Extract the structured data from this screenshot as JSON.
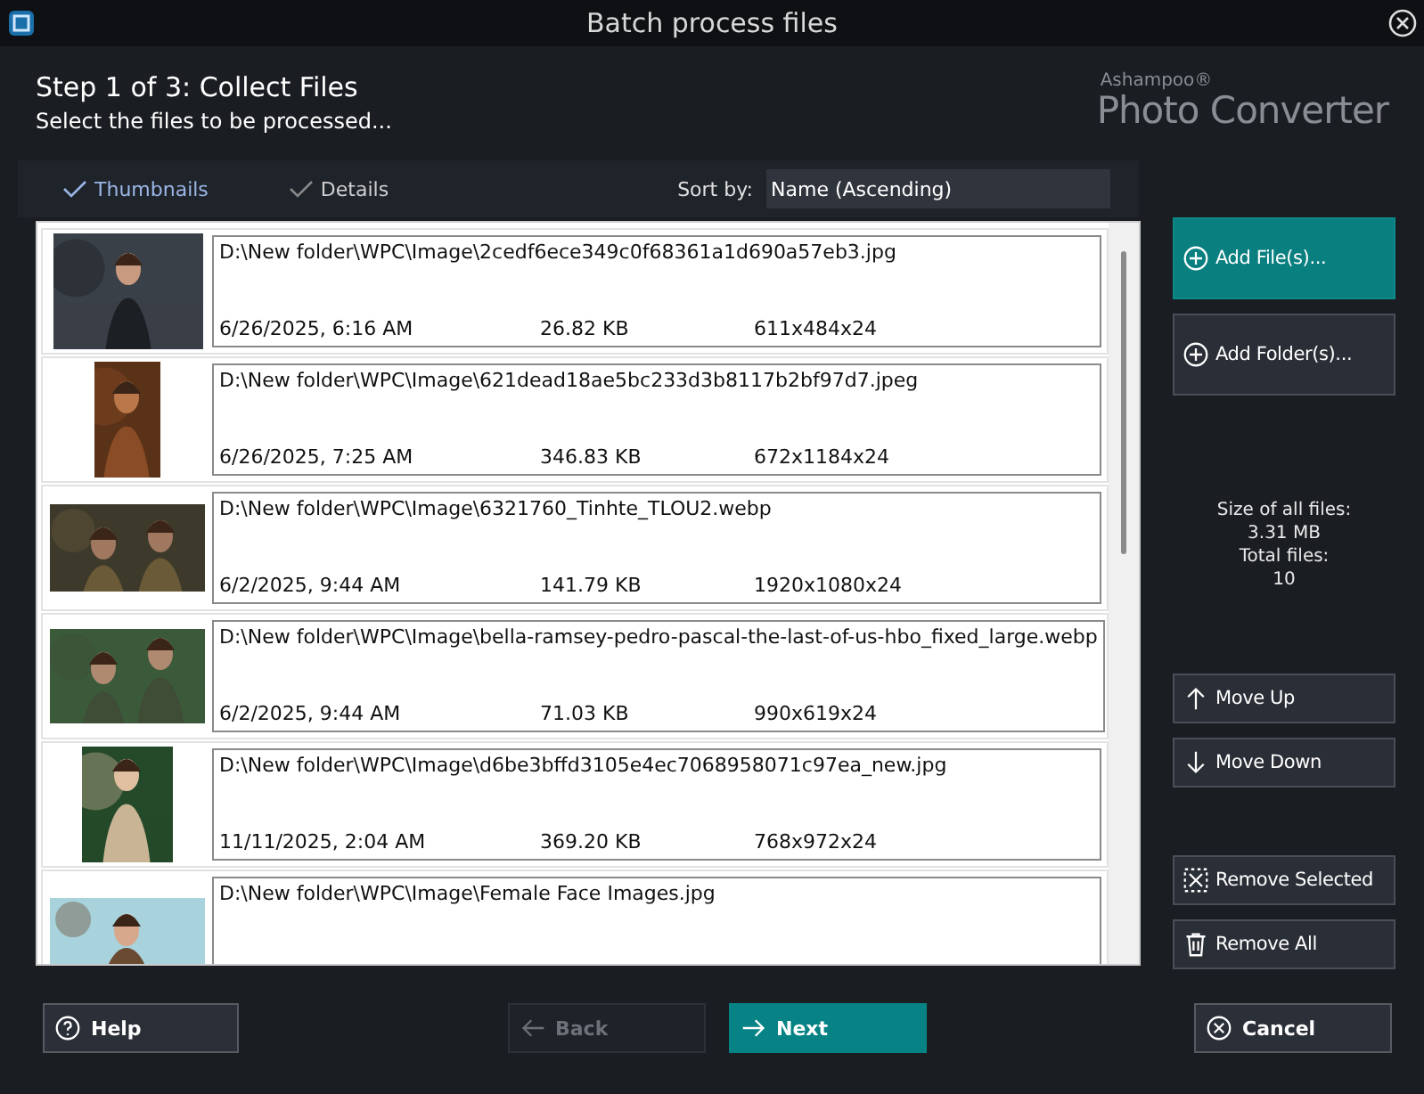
{
  "window": {
    "title": "Batch process files"
  },
  "header": {
    "step": "Step 1 of 3: Collect Files",
    "subtitle": "Select the files to be processed...",
    "brand_small": "Ashampoo®",
    "brand_large": "Photo Converter"
  },
  "views": [
    {
      "label": "Thumbnails",
      "selected": true
    },
    {
      "label": "Details",
      "selected": false
    }
  ],
  "sort": {
    "label": "Sort by:",
    "value": "Name (Ascending)"
  },
  "files": [
    {
      "kind": "picture",
      "path": "D:\\New folder\\WPC\\Image\\2cedf6ece349c0f68361a1d690a57eb3.jpg",
      "date": "6/26/2025, 6:16 AM",
      "size": "26.82 KB",
      "dimensions": "611x484x24"
    },
    {
      "kind": "picture",
      "path": "D:\\New folder\\WPC\\Image\\621dead18ae5bc233d3b8117b2bf97d7.jpeg",
      "date": "6/26/2025, 7:25 AM",
      "size": "346.83 KB",
      "dimensions": "672x1184x24"
    },
    {
      "kind": "picture",
      "path": "D:\\New folder\\WPC\\Image\\6321760_Tinhte_TLOU2.webp",
      "date": "6/2/2025, 9:44 AM",
      "size": "141.79 KB",
      "dimensions": "1920x1080x24"
    },
    {
      "kind": "picture",
      "path": "D:\\New folder\\WPC\\Image\\bella-ramsey-pedro-pascal-the-last-of-us-hbo_fixed_large.webp",
      "date": "6/2/2025, 9:44 AM",
      "size": "71.03 KB",
      "dimensions": "990x619x24"
    },
    {
      "kind": "picture",
      "path": "D:\\New folder\\WPC\\Image\\d6be3bffd3105e4ec7068958071c97ea_new.jpg",
      "date": "11/11/2025, 2:04 AM",
      "size": "369.20 KB",
      "dimensions": "768x972x24"
    },
    {
      "kind": "picture",
      "path": "D:\\New folder\\WPC\\Image\\Female Face Images.jpg"
    }
  ],
  "side_buttons": [
    {
      "label": "Add File(s)...",
      "primary": true
    },
    {
      "label": "Add Folder(s)...",
      "primary": false
    }
  ],
  "summary": [
    "Size of all files:",
    "3.31 MB",
    "Total files:",
    "10"
  ],
  "move_buttons": [
    {
      "label": "Move Up"
    },
    {
      "label": "Move Down"
    }
  ],
  "remove_buttons": [
    {
      "label": "Remove Selected"
    },
    {
      "label": "Remove All"
    }
  ],
  "footer": {
    "help": {
      "label": "Help"
    },
    "nav": [
      {
        "label": "Back",
        "primary": false,
        "disabled": true
      },
      {
        "label": "Next",
        "primary": true,
        "disabled": false
      }
    ],
    "cancel": {
      "label": "Cancel"
    }
  }
}
